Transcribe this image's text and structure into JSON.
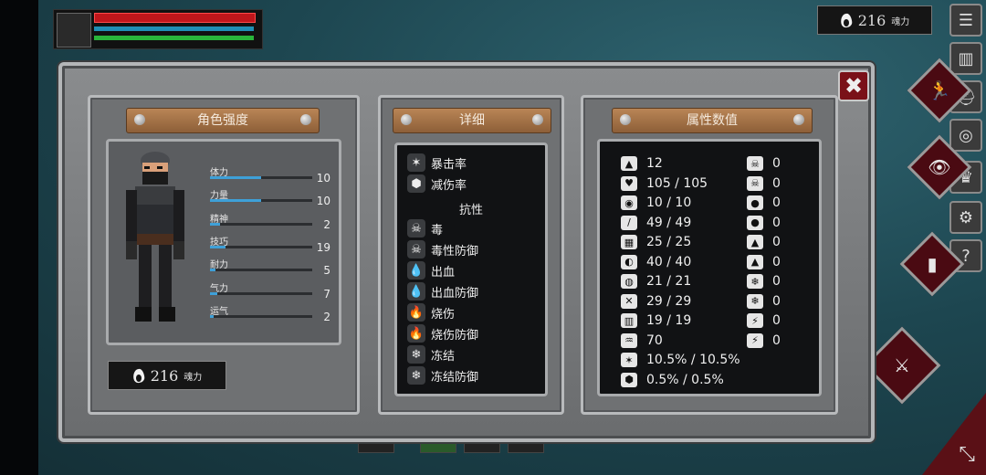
{
  "hud": {
    "hp": 1.0,
    "mp": 1.0,
    "stamina": 1.0
  },
  "souls": {
    "value": "216",
    "unit": "魂力"
  },
  "tools": [
    "list-icon",
    "door-icon",
    "helmet-icon",
    "shield-emblem-icon",
    "crown-icon",
    "gear-icon",
    "help-icon"
  ],
  "tool_help": "?",
  "panels": {
    "character": {
      "title": "角色强度"
    },
    "details": {
      "title": "详细"
    },
    "attributes": {
      "title": "属性数值"
    }
  },
  "stats": [
    {
      "label": "体力",
      "value": "10",
      "level": 0.5
    },
    {
      "label": "力量",
      "value": "10",
      "level": 0.5
    },
    {
      "label": "精神",
      "value": "2",
      "level": 0.1
    },
    {
      "label": "技巧",
      "value": "19",
      "level": 0.15
    },
    {
      "label": "耐力",
      "value": "5",
      "level": 0.05
    },
    {
      "label": "气力",
      "value": "7",
      "level": 0.07
    },
    {
      "label": "运气",
      "value": "2",
      "level": 0.02
    }
  ],
  "details": {
    "rows_top": [
      {
        "icon": "crit-icon",
        "glyph": "✶",
        "label": "暴击率"
      },
      {
        "icon": "damage-reduction-icon",
        "glyph": "⬢",
        "label": "减伤率"
      }
    ],
    "resist_header": "抗性",
    "rows": [
      {
        "icon": "poison-icon",
        "glyph": "☠",
        "label": "毒"
      },
      {
        "icon": "poison-defense-icon",
        "glyph": "☠",
        "label": "毒性防御"
      },
      {
        "icon": "bleed-icon",
        "glyph": "💧",
        "label": "出血"
      },
      {
        "icon": "bleed-defense-icon",
        "glyph": "💧",
        "label": "出血防御"
      },
      {
        "icon": "burn-icon",
        "glyph": "🔥",
        "label": "烧伤"
      },
      {
        "icon": "burn-defense-icon",
        "glyph": "🔥",
        "label": "烧伤防御"
      },
      {
        "icon": "freeze-icon",
        "glyph": "❄",
        "label": "冻结"
      },
      {
        "icon": "freeze-defense-icon",
        "glyph": "❄",
        "label": "冻结防御"
      }
    ]
  },
  "attributes_left": [
    {
      "icon": "level-icon",
      "glyph": "▲",
      "value": "12"
    },
    {
      "icon": "health-icon",
      "glyph": "♥",
      "value": "105 / 105"
    },
    {
      "icon": "spirit-icon",
      "glyph": "◉",
      "value": "10 / 10"
    },
    {
      "icon": "stamina-icon",
      "glyph": "/",
      "value": "49 / 49"
    },
    {
      "icon": "equip-load-icon",
      "glyph": "▦",
      "value": "25 / 25"
    },
    {
      "icon": "defense-icon",
      "glyph": "◐",
      "value": "40 / 40"
    },
    {
      "icon": "poise-icon",
      "glyph": "◍",
      "value": "21 / 21"
    },
    {
      "icon": "agility-icon",
      "glyph": "✕",
      "value": "29 / 29"
    },
    {
      "icon": "armor-icon",
      "glyph": "▥",
      "value": "19 / 19"
    },
    {
      "icon": "lungs-icon",
      "glyph": "♒",
      "value": "70"
    },
    {
      "icon": "crit-rate-icon",
      "glyph": "✶",
      "value": "10.5% / 10.5%"
    },
    {
      "icon": "reduction-icon",
      "glyph": "⬢",
      "value": "0.5% / 0.5%"
    }
  ],
  "attributes_right": [
    {
      "icon": "poison-icon",
      "glyph": "☠",
      "value": "0"
    },
    {
      "icon": "poison-defense-icon",
      "glyph": "☠",
      "value": "0"
    },
    {
      "icon": "bleed-icon",
      "glyph": "●",
      "value": "0"
    },
    {
      "icon": "bleed-defense-icon",
      "glyph": "●",
      "value": "0"
    },
    {
      "icon": "burn-icon",
      "glyph": "▲",
      "value": "0"
    },
    {
      "icon": "burn-defense-icon",
      "glyph": "▲",
      "value": "0"
    },
    {
      "icon": "freeze-icon",
      "glyph": "❄",
      "value": "0"
    },
    {
      "icon": "freeze-defense-icon",
      "glyph": "❄",
      "value": "0"
    },
    {
      "icon": "lightning-icon",
      "glyph": "⚡",
      "value": "0"
    },
    {
      "icon": "lightning-defense-icon",
      "glyph": "⚡",
      "value": "0"
    }
  ]
}
